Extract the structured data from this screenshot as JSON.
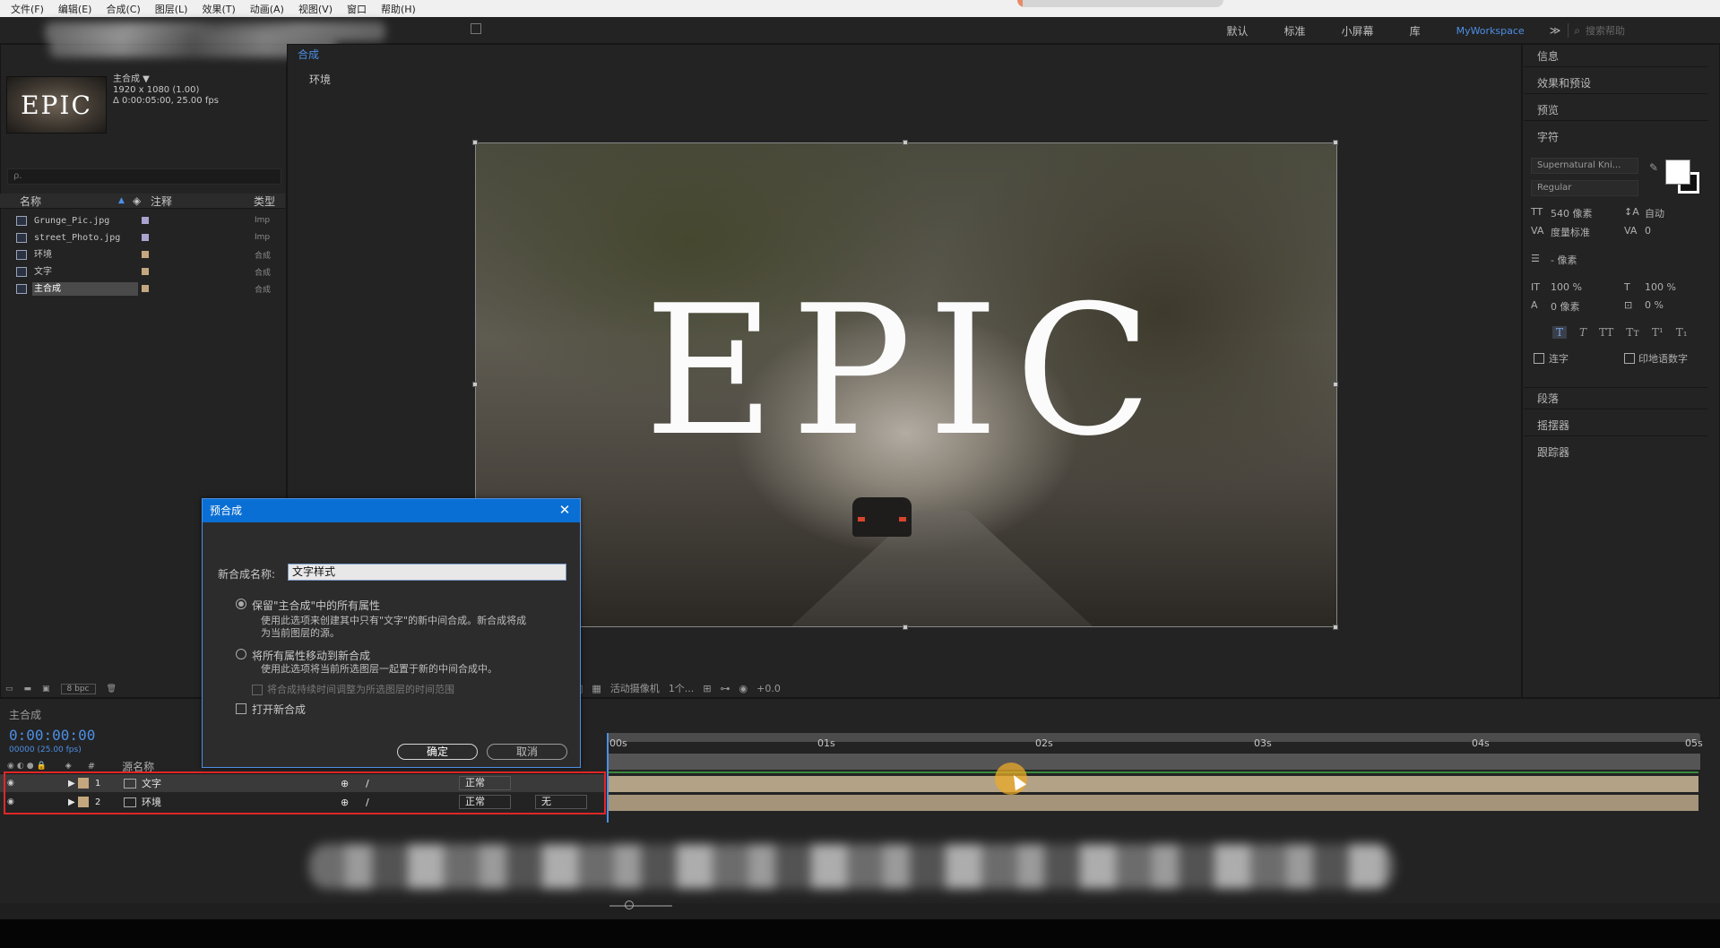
{
  "menubar": {
    "items": [
      "文件(F)",
      "编辑(E)",
      "合成(C)",
      "图层(L)",
      "效果(T)",
      "动画(A)",
      "视图(V)",
      "窗口",
      "帮助(H)"
    ]
  },
  "workspace": {
    "items": [
      "默认",
      "标准",
      "小屏幕",
      "库"
    ],
    "active": "MyWorkspace",
    "search_placeholder": "搜索帮助"
  },
  "project": {
    "comp_name": "主合成 ▼",
    "comp_res": "1920 x 1080 (1.00)",
    "comp_dur": "Δ 0:00:05:00, 25.00 fps",
    "thumb_text": "EPIC",
    "search_placeholder": "ρ.",
    "col_name": "名称",
    "col_comment": "注释",
    "col_type": "类型",
    "items": [
      {
        "name": "Grunge_Pic.jpg",
        "type": "Imp",
        "color": "#a9a3cf"
      },
      {
        "name": "street_Photo.jpg",
        "type": "Imp",
        "color": "#a9a3cf"
      },
      {
        "name": "环境",
        "type": "合成",
        "color": "#c5a77f"
      },
      {
        "name": "文字",
        "type": "合成",
        "color": "#c5a77f"
      },
      {
        "name": "主合成",
        "type": "合成",
        "color": "#c5a77f"
      }
    ],
    "bpc": "8 bpc"
  },
  "viewer": {
    "tab_label": "合成",
    "sub_label": "环境",
    "epic_text": "EPIC",
    "footer_camera": "活动摄像机",
    "footer_views": "1个...",
    "footer_exposure": "+0.0"
  },
  "right_panel": {
    "sections": [
      "信息",
      "效果和预设",
      "预览",
      "字符",
      "段落",
      "摇摆器",
      "跟踪器"
    ],
    "font_family": "Supernatural Kni...",
    "font_style": "Regular",
    "font_size": "540 像素",
    "leading": "自动",
    "kerning": "度量标准",
    "tracking": "0",
    "stroke_width": "- 像素",
    "v_scale": "100 %",
    "h_scale": "100 %",
    "baseline": "0 像素",
    "tsume": "0 %",
    "ligatures": "连字",
    "hindi_digits": "印地语数字"
  },
  "timeline": {
    "tab_label": "主合成",
    "timecode": "0:00:00:00",
    "frame_info": "00000 (25.00 fps)",
    "col_source": "源名称",
    "ticks": [
      "00s",
      "01s",
      "02s",
      "03s",
      "04s",
      "05s"
    ],
    "layers": [
      {
        "num": "1",
        "name": "文字",
        "mode": "正常",
        "color": "#c5a77f",
        "track": ""
      },
      {
        "num": "2",
        "name": "环境",
        "mode": "正常",
        "color": "#c5a77f",
        "track": "无"
      }
    ]
  },
  "dialog": {
    "title": "预合成",
    "name_label": "新合成名称:",
    "name_value": "文字样式",
    "opt1_label": "保留\"主合成\"中的所有属性",
    "opt1_desc1": "使用此选项来创建其中只有\"文字\"的新中间合成。新合成将成",
    "opt1_desc2": "为当前图层的源。",
    "opt2_label": "将所有属性移动到新合成",
    "opt2_desc": "使用此选项将当前所选图层一起置于新的中间合成中。",
    "adjust_label": "将合成持续时间调整为所选图层的时间范围",
    "open_label": "打开新合成",
    "ok": "确定",
    "cancel": "取消"
  }
}
